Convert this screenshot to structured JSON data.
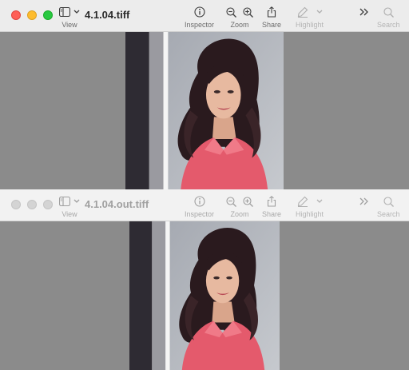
{
  "windows": [
    {
      "title": "4.1.04.tiff",
      "state": "active",
      "toolbar": {
        "view_label": "View",
        "inspector_label": "Inspector",
        "zoom_label": "Zoom",
        "share_label": "Share",
        "highlight_label": "Highlight",
        "search_label": "Search"
      },
      "icons": [
        "sidebar-icon",
        "chevron-down-icon",
        "info-icon",
        "zoom-out-icon",
        "zoom-in-icon",
        "share-icon",
        "highlight-pen-icon",
        "chevron-down-icon",
        "more-chevrons-icon",
        "search-icon"
      ]
    },
    {
      "title": "4.1.04.out.tiff",
      "state": "inactive",
      "toolbar": {
        "view_label": "View",
        "inspector_label": "Inspector",
        "zoom_label": "Zoom",
        "share_label": "Share",
        "highlight_label": "Highlight",
        "search_label": "Search"
      },
      "icons": [
        "sidebar-icon",
        "chevron-down-icon",
        "info-icon",
        "zoom-out-icon",
        "zoom-in-icon",
        "share-icon",
        "highlight-pen-icon",
        "chevron-down-icon",
        "more-chevrons-icon",
        "search-icon"
      ]
    }
  ],
  "colors": {
    "canvas_bg": "#8b8b8b",
    "close": "#fe5f57",
    "minimize": "#febc2e",
    "maximize": "#28c840",
    "shirt": "#e45a6c",
    "hair": "#2a1a1e"
  }
}
